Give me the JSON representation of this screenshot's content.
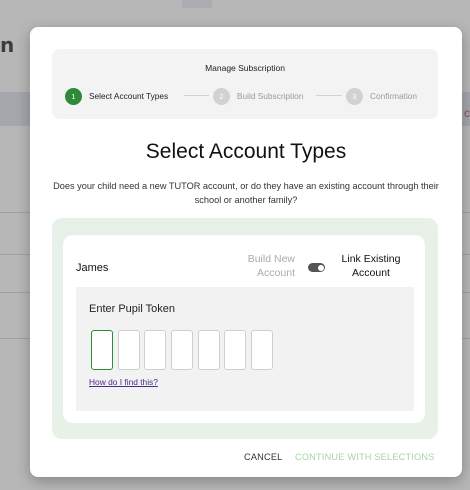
{
  "background": {
    "title_fragment": "n",
    "right_edge_fragment": "c"
  },
  "modal": {
    "stepper": {
      "title": "Manage Subscription",
      "steps": [
        {
          "number": "1",
          "label": "Select Account Types",
          "state": "active"
        },
        {
          "number": "2",
          "label": "Build Subscription",
          "state": "inactive"
        },
        {
          "number": "3",
          "label": "Confirmation",
          "state": "inactive"
        }
      ]
    },
    "heading": "Select Account Types",
    "description": "Does your child need a new TUTOR account, or do they have an existing account through their school or another family?",
    "student": {
      "name": "James",
      "option_new": "Build New Account",
      "option_link": "Link Existing Account",
      "toggle_state": "link-existing",
      "token": {
        "label": "Enter Pupil Token",
        "box_count": 7,
        "values": [
          "",
          "",
          "",
          "",
          "",
          "",
          ""
        ],
        "help_link": "How do I find this?"
      }
    },
    "actions": {
      "cancel": "CANCEL",
      "continue": "CONTINUE WITH SELECTIONS"
    }
  },
  "colors": {
    "accent_green": "#2d8a3a",
    "disabled_green": "#a8d3a5",
    "link_purple": "#4a2a8a"
  }
}
